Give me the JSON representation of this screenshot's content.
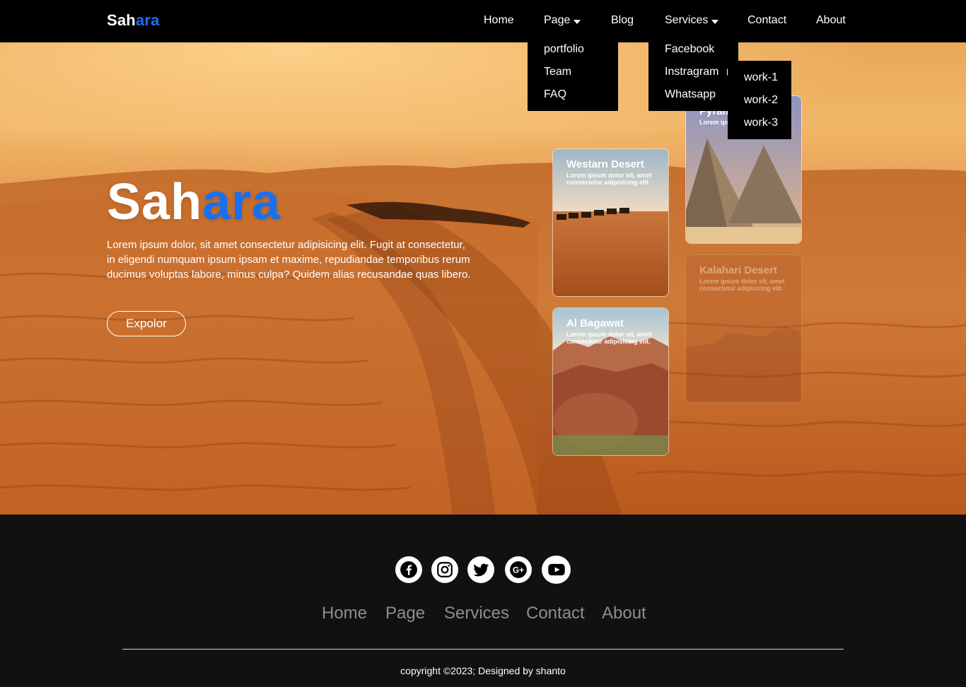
{
  "brand": {
    "prefix": "Sah",
    "accent": "ara",
    "accent_color": "#1a6ff0"
  },
  "nav": {
    "home": "Home",
    "page": "Page",
    "blog": "Blog",
    "services": "Services",
    "contact": "Contact",
    "about": "About"
  },
  "page_menu": [
    "portfolio",
    "Team",
    "FAQ"
  ],
  "services_menu": [
    "Facebook",
    "Instragram",
    "Whatsapp"
  ],
  "instagram_submenu": [
    "work-1",
    "work-2",
    "work-3"
  ],
  "hero": {
    "title_prefix": "Sah",
    "title_accent": "ara",
    "text": "Lorem ipsum dolor, sit amet consectetur adipisicing elit. Fugit at consectetur, in eligendi numquam ipsum ipsam et maxime, repudiandae temporibus rerum ducimus voluptas labore, minus culpa? Quidem alias recusandae quas libero.",
    "button": "Expolor"
  },
  "cards": [
    {
      "title": "Westarn Desert",
      "desc": "Lorem ipsum dolor sit, amet consectetur adipisicing elit."
    },
    {
      "title": "Al Bagawat",
      "desc": "Lorem ipsum dolor sit, amet consectetur adipisicing elit."
    },
    {
      "title": "Pyram",
      "desc": "Lorem ips consectet"
    },
    {
      "title": "Kalahari Desert",
      "desc": "Lorem ipsum dolor sit, amet consectetur adipisicing elit."
    }
  ],
  "social": [
    "facebook-icon",
    "instagram-icon",
    "twitter-icon",
    "google-plus-icon",
    "youtube-icon"
  ],
  "footer_links": [
    "Home",
    "Page",
    "Services",
    "Contact",
    "About"
  ],
  "copyright": "copyright ©2023; Designed by shanto"
}
